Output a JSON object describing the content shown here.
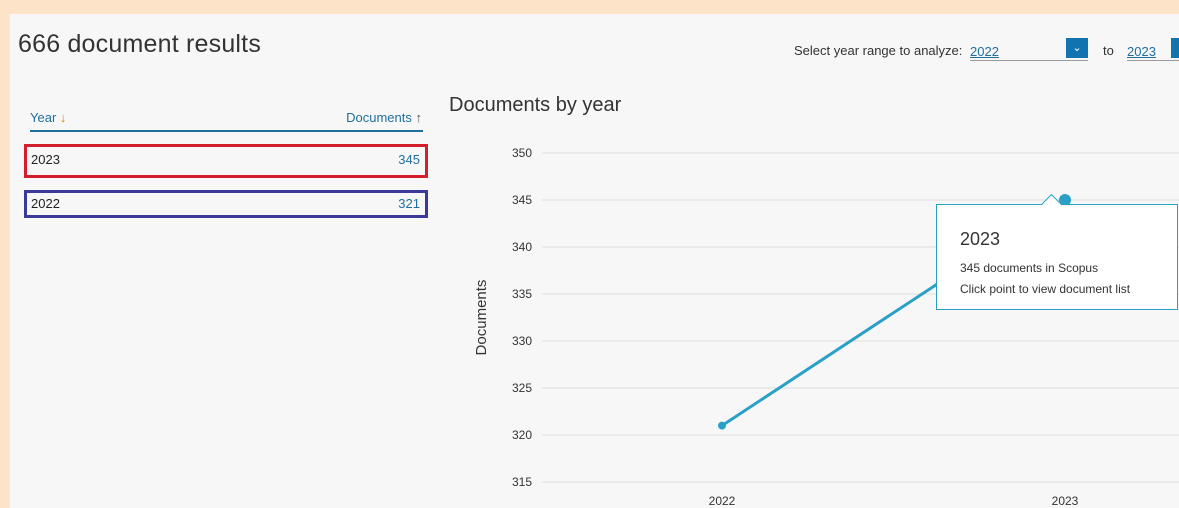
{
  "header": {
    "results_title": "666 document results",
    "year_range_label": "Select year range to analyze:",
    "from_year": "2022",
    "to_label": "to",
    "to_year": "2023"
  },
  "table": {
    "col_year": "Year",
    "col_docs": "Documents",
    "rows": [
      {
        "year": "2023",
        "documents": "345"
      },
      {
        "year": "2022",
        "documents": "321"
      }
    ]
  },
  "chart_title": "Documents by year",
  "tooltip": {
    "year": "2023",
    "line1": "345 documents in Scopus",
    "line2": "Click point to view document list"
  },
  "colors": {
    "accent": "#1f6f9e",
    "series": "#2aa0c7",
    "highlight_red": "#d31f2c",
    "highlight_blue": "#3b3a9b"
  },
  "chart_data": {
    "type": "line",
    "title": "Documents by year",
    "xlabel": "",
    "ylabel": "Documents",
    "categories": [
      "2022",
      "2023"
    ],
    "values": [
      321,
      345
    ],
    "ylim": [
      315,
      350
    ],
    "yticks": [
      350,
      345,
      340,
      335,
      330,
      325,
      320,
      315
    ],
    "grid": true
  }
}
